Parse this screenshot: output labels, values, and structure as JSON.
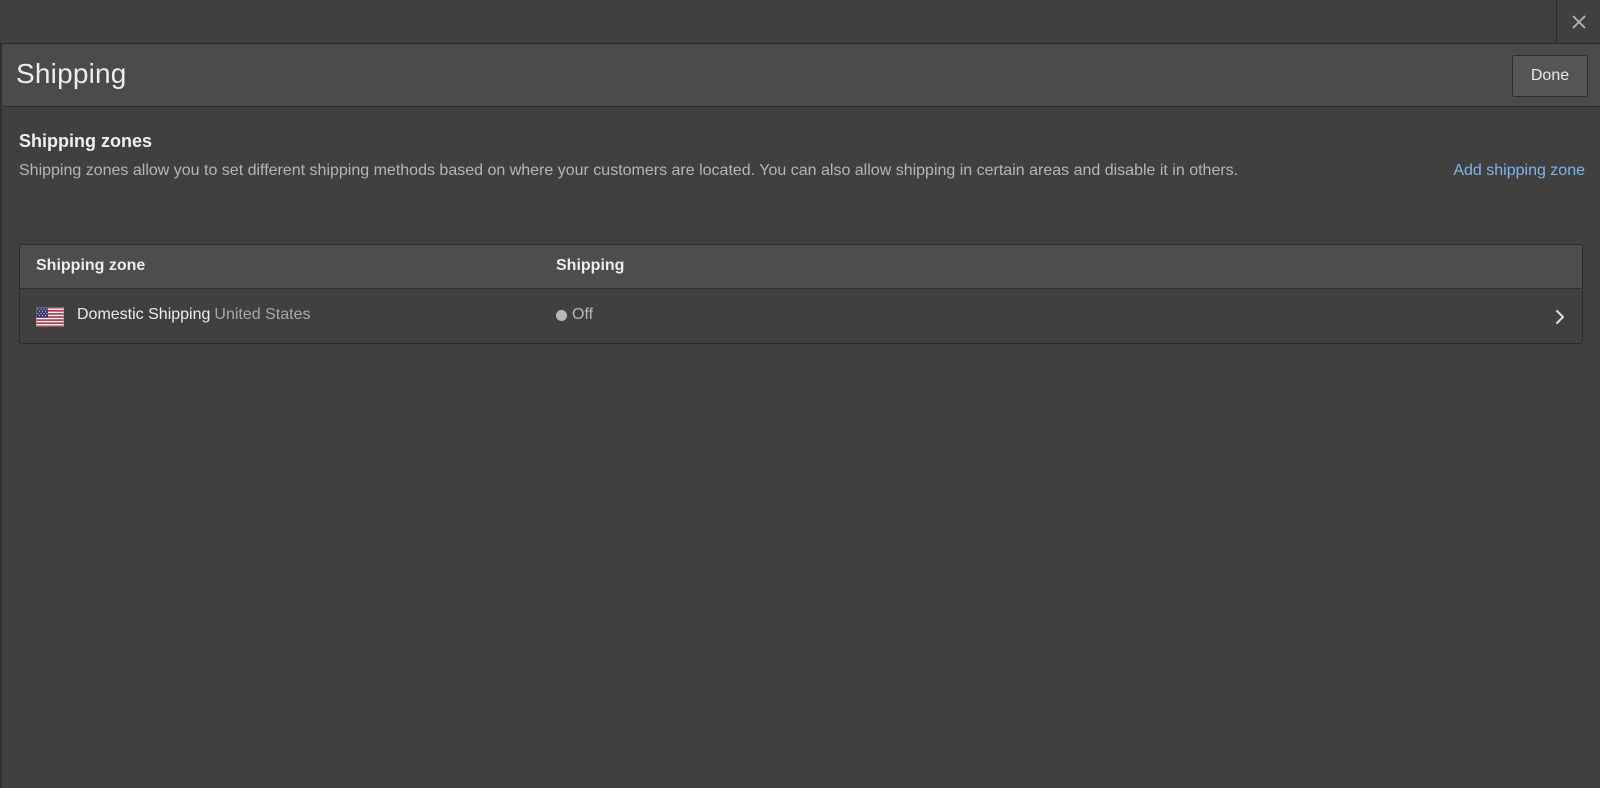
{
  "topbar": {
    "close_icon": "close-icon"
  },
  "header": {
    "title": "Shipping",
    "done_label": "Done"
  },
  "section": {
    "title": "Shipping zones",
    "description": "Shipping zones allow you to set different shipping methods based on where your customers are located. You can also allow shipping in certain areas and disable it in others.",
    "add_link": "Add shipping zone"
  },
  "table": {
    "columns": [
      "Shipping zone",
      "Shipping"
    ],
    "rows": [
      {
        "flag_icon": "us-flag-icon",
        "name": "Domestic Shipping",
        "region": "United States",
        "status": "Off",
        "status_color": "#b9b9b9"
      }
    ]
  },
  "colors": {
    "background": "#404040",
    "header": "#4b4b4b",
    "link": "#7fb4ec"
  }
}
